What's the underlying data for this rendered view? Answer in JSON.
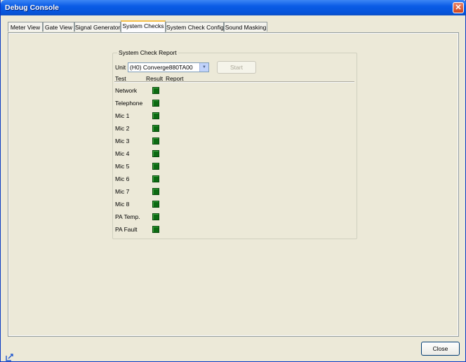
{
  "window": {
    "title": "Debug Console"
  },
  "tabs": [
    {
      "label": "Meter View"
    },
    {
      "label": "Gate View"
    },
    {
      "label": "Signal Generator"
    },
    {
      "label": "System Checks",
      "active": true
    },
    {
      "label": "System Check Config"
    },
    {
      "label": "Sound Masking"
    }
  ],
  "report": {
    "group_title": "System Check Report",
    "unit_label": "Unit",
    "unit_value": "(H0) Converge880TA00",
    "start_label": "Start",
    "columns": [
      "Test",
      "Result",
      "Report"
    ],
    "rows": [
      {
        "test": "Network",
        "result": "pass"
      },
      {
        "test": "Telephone",
        "result": "pass"
      },
      {
        "test": "Mic 1",
        "result": "pass"
      },
      {
        "test": "Mic 2",
        "result": "pass"
      },
      {
        "test": "Mic 3",
        "result": "pass"
      },
      {
        "test": "Mic 4",
        "result": "pass"
      },
      {
        "test": "Mic 5",
        "result": "pass"
      },
      {
        "test": "Mic 6",
        "result": "pass"
      },
      {
        "test": "Mic 7",
        "result": "pass"
      },
      {
        "test": "Mic 8",
        "result": "pass"
      },
      {
        "test": "PA Temp.",
        "result": "pass"
      },
      {
        "test": "PA Fault",
        "result": "pass"
      }
    ]
  },
  "footer": {
    "close_label": "Close"
  },
  "colors": {
    "led_green": "#0c6a12",
    "titlebar": "#0a5ce6"
  }
}
